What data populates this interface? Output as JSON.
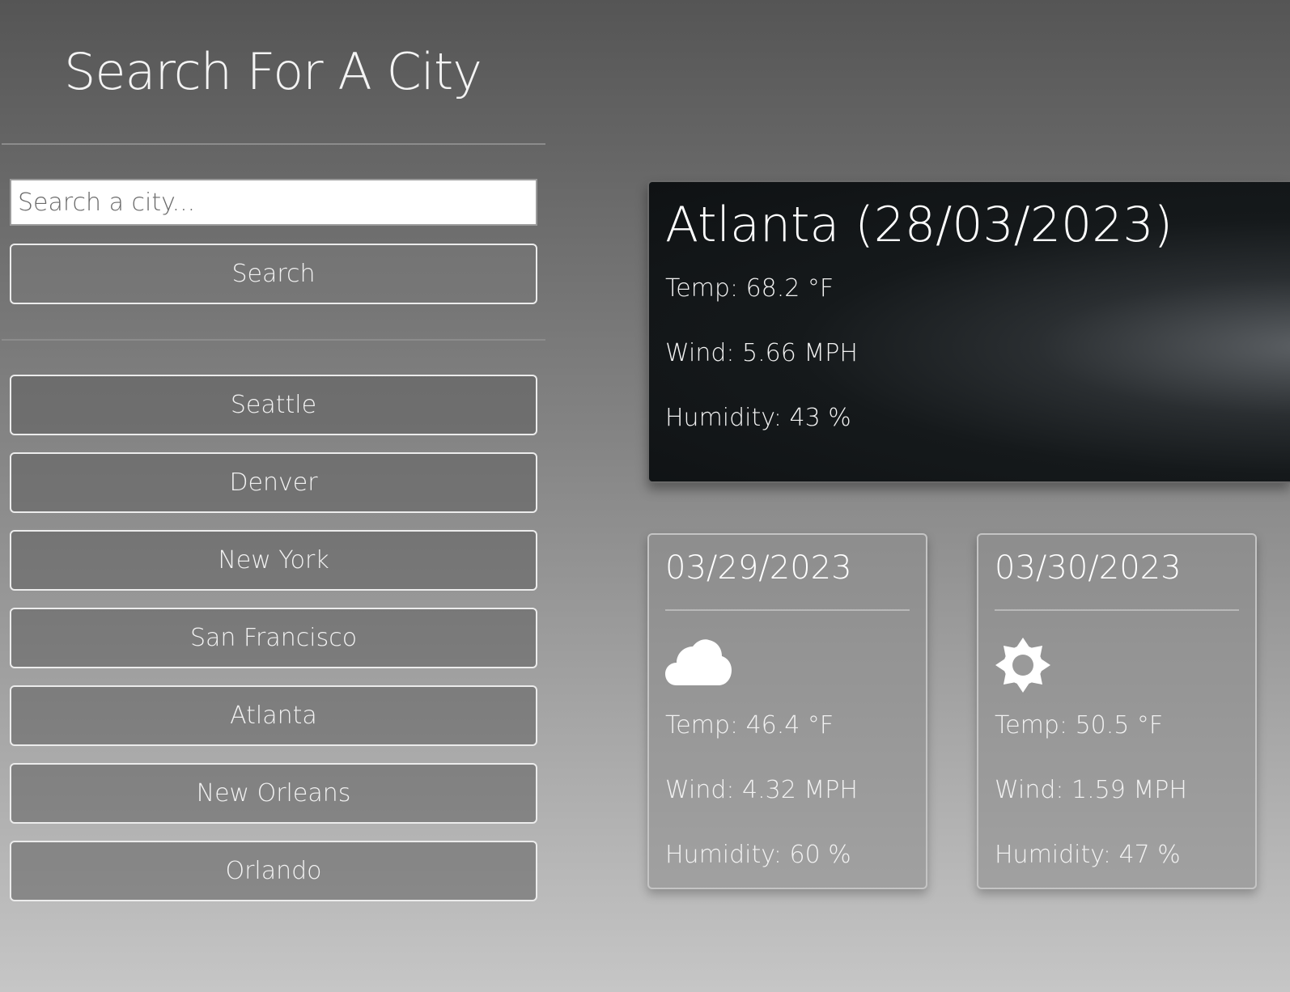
{
  "sidebar": {
    "title": "Search For A City",
    "search": {
      "placeholder": "Search a city...",
      "value": ""
    },
    "search_button": "Search",
    "history": [
      "Seattle",
      "Denver",
      "New York",
      "San Francisco",
      "Atlanta",
      "New Orleans",
      "Orlando"
    ]
  },
  "today": {
    "title": "Atlanta (28/03/2023)",
    "temp": "Temp: 68.2 °F",
    "wind": "Wind: 5.66 MPH",
    "humidity": "Humidity: 43 %"
  },
  "forecast": [
    {
      "date": "03/29/2023",
      "icon": "cloud-icon",
      "temp": "Temp: 46.4 °F",
      "wind": "Wind: 4.32 MPH",
      "humidity": "Humidity: 60 %"
    },
    {
      "date": "03/30/2023",
      "icon": "sun-icon",
      "temp": "Temp: 50.5 °F",
      "wind": "Wind: 1.59 MPH",
      "humidity": "Humidity: 47 %"
    }
  ]
}
